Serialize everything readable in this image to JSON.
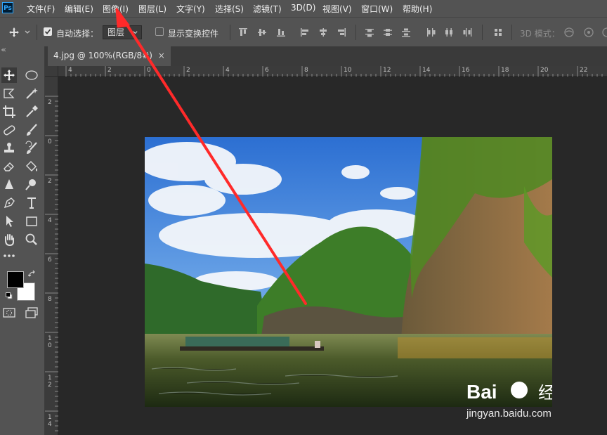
{
  "app": {
    "logo_text": "Ps"
  },
  "menu": [
    {
      "label": "文件(F)"
    },
    {
      "label": "编辑(E)"
    },
    {
      "label": "图像(I)"
    },
    {
      "label": "图层(L)"
    },
    {
      "label": "文字(Y)"
    },
    {
      "label": "选择(S)"
    },
    {
      "label": "滤镜(T)"
    },
    {
      "label": "3D(D)"
    },
    {
      "label": "视图(V)"
    },
    {
      "label": "窗口(W)"
    },
    {
      "label": "帮助(H)"
    }
  ],
  "options": {
    "auto_select_label": "自动选择：",
    "auto_select_checked": true,
    "layer_select_value": "图层",
    "show_transform_label": "显示变换控件",
    "show_transform_checked": false,
    "mode_3d_label": "3D 模式："
  },
  "document": {
    "tab_title": "4.jpg @ 100%(RGB/8#)",
    "close_symbol": "×"
  },
  "ruler_top": [
    "4",
    "2",
    "0",
    "2",
    "4",
    "6",
    "8",
    "10",
    "12",
    "14",
    "16",
    "18",
    "20",
    "22"
  ],
  "ruler_left": [
    "2",
    "0",
    "2",
    "4",
    "6",
    "8",
    "1\n0",
    "1\n2",
    "1\n4"
  ],
  "watermark": {
    "brand": "Bai",
    "brand2": "经验",
    "url": "jingyan.baidu.com"
  },
  "colors": {
    "foreground": "#000000",
    "background": "#ffffff",
    "annotation_arrow": "#ff2a2a"
  }
}
